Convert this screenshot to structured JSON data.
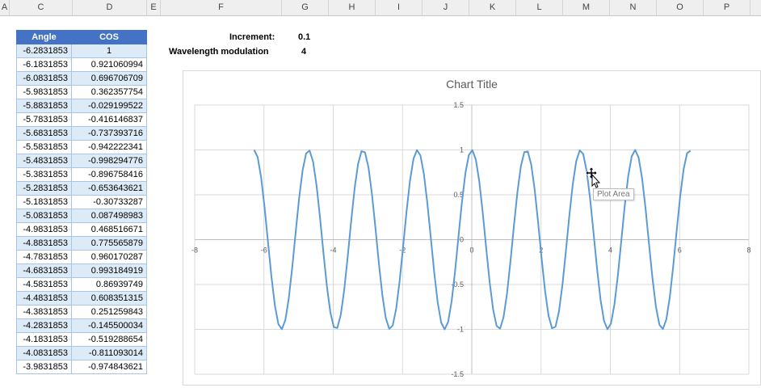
{
  "column_headers": [
    "A",
    "C",
    "D",
    "E",
    "F",
    "G",
    "H",
    "I",
    "J",
    "K",
    "L",
    "M",
    "N",
    "O",
    "P"
  ],
  "table": {
    "headers": [
      "Angle",
      "COS"
    ],
    "rows": [
      [
        "-6.2831853",
        "1"
      ],
      [
        "-6.1831853",
        "0.921060994"
      ],
      [
        "-6.0831853",
        "0.696706709"
      ],
      [
        "-5.9831853",
        "0.362357754"
      ],
      [
        "-5.8831853",
        "-0.029199522"
      ],
      [
        "-5.7831853",
        "-0.416146837"
      ],
      [
        "-5.6831853",
        "-0.737393716"
      ],
      [
        "-5.5831853",
        "-0.942222341"
      ],
      [
        "-5.4831853",
        "-0.998294776"
      ],
      [
        "-5.3831853",
        "-0.896758416"
      ],
      [
        "-5.2831853",
        "-0.653643621"
      ],
      [
        "-5.1831853",
        "-0.30733287"
      ],
      [
        "-5.0831853",
        "0.087498983"
      ],
      [
        "-4.9831853",
        "0.468516671"
      ],
      [
        "-4.8831853",
        "0.775565879"
      ],
      [
        "-4.7831853",
        "0.960170287"
      ],
      [
        "-4.6831853",
        "0.993184919"
      ],
      [
        "-4.5831853",
        "0.86939749"
      ],
      [
        "-4.4831853",
        "0.608351315"
      ],
      [
        "-4.3831853",
        "0.251259843"
      ],
      [
        "-4.2831853",
        "-0.145500034"
      ],
      [
        "-4.1831853",
        "-0.519288654"
      ],
      [
        "-4.0831853",
        "-0.811093014"
      ],
      [
        "-3.9831853",
        "-0.974843621"
      ]
    ]
  },
  "params": {
    "increment_label": "Increment:",
    "increment_value": "0.1",
    "wavelength_label": "Wavelength modulation",
    "wavelength_value": "4"
  },
  "tooltip": "Plot Area",
  "chart_data": {
    "type": "scatter",
    "title": "Chart Title",
    "xlim": [
      -8,
      8
    ],
    "ylim": [
      -1.5,
      1.5
    ],
    "x_ticks": [
      -8,
      -6,
      -4,
      -2,
      0,
      2,
      4,
      6,
      8
    ],
    "y_ticks": [
      -1.5,
      -1,
      -0.5,
      0,
      0.5,
      1,
      1.5
    ],
    "grid": true,
    "function": "y = cos(4x)",
    "x_start": -6.2831853,
    "x_end": 6.2831853,
    "x_step": 0.1,
    "line_color": "#5b9bd5",
    "gridline_color": "#d9d9d9"
  },
  "colors": {
    "header_fill": "#4472c4",
    "band_fill": "#ddebf7",
    "series": "#5b9bd5"
  }
}
